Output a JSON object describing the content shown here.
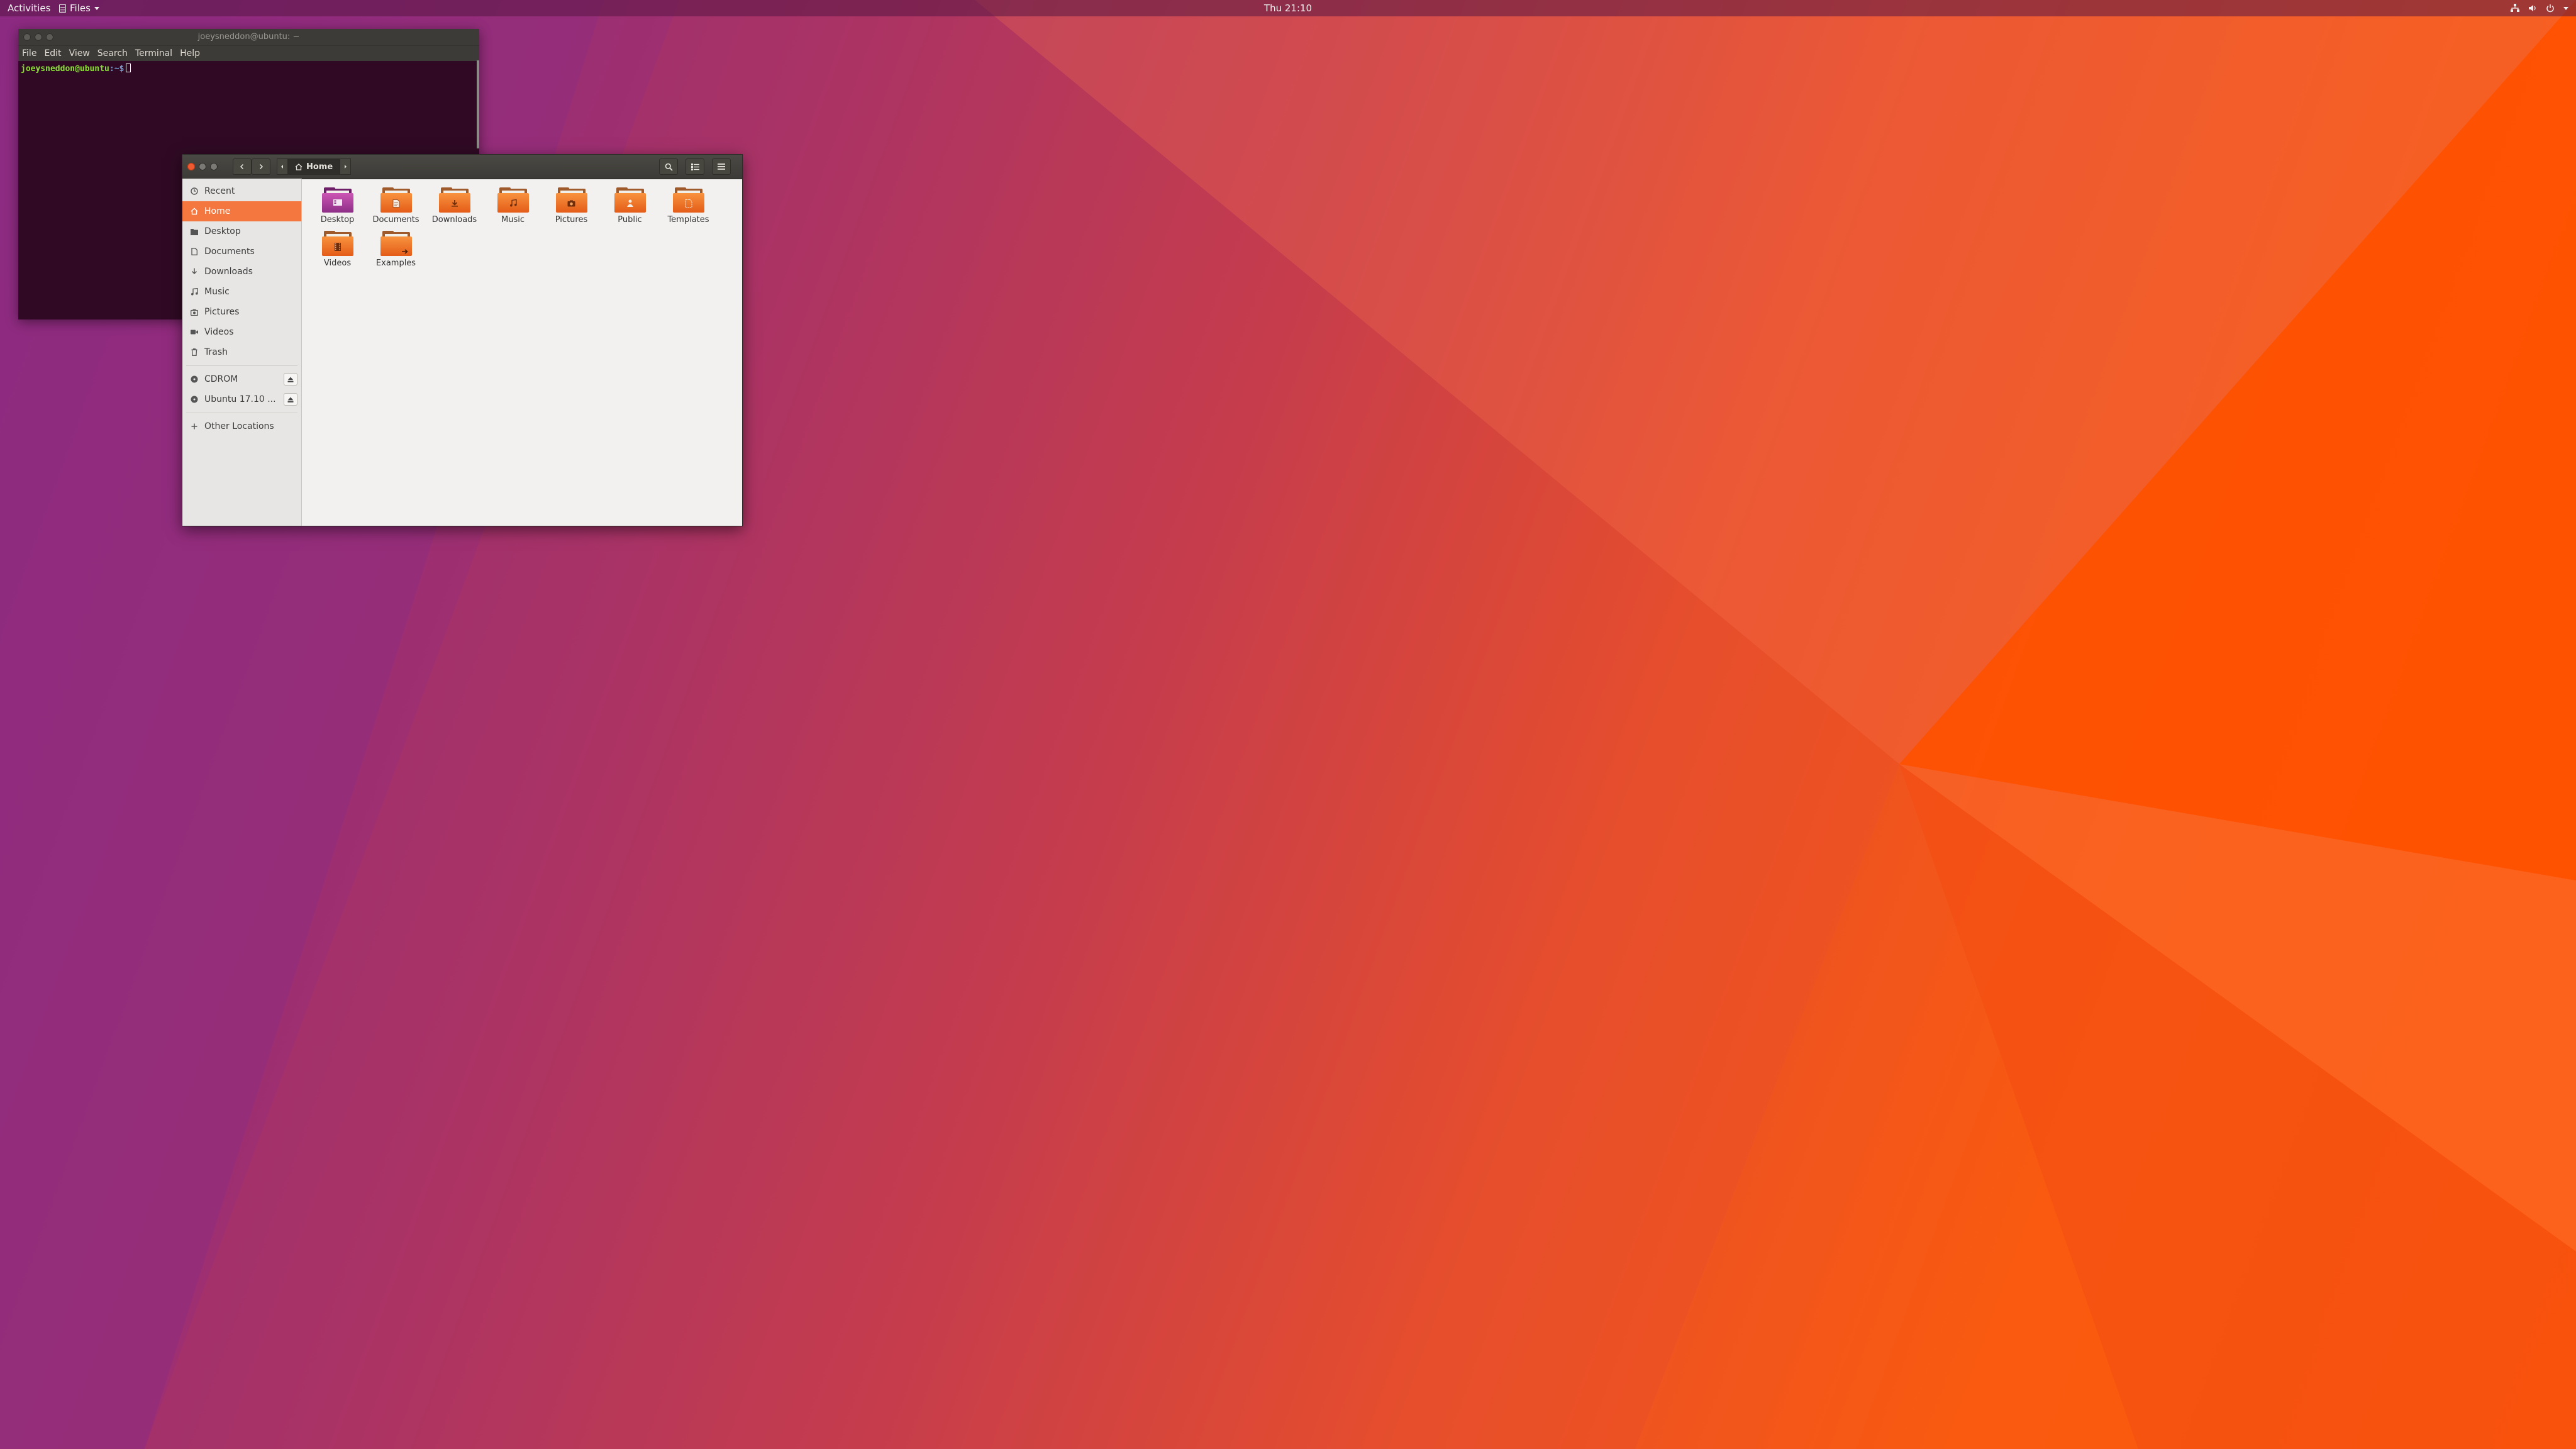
{
  "topbar": {
    "activities": "Activities",
    "app_menu": "Files",
    "clock": "Thu 21:10"
  },
  "terminal": {
    "title": "joeysneddon@ubuntu: ~",
    "menu": [
      "File",
      "Edit",
      "View",
      "Search",
      "Terminal",
      "Help"
    ],
    "prompt_user": "joeysneddon@ubuntu",
    "prompt_path": ":~$"
  },
  "files": {
    "path_current": "Home",
    "sidebar": {
      "places": [
        {
          "label": "Recent",
          "icon": "clock-icon",
          "active": false
        },
        {
          "label": "Home",
          "icon": "home-icon",
          "active": true
        },
        {
          "label": "Desktop",
          "icon": "folder-icon",
          "active": false
        },
        {
          "label": "Documents",
          "icon": "document-icon",
          "active": false
        },
        {
          "label": "Downloads",
          "icon": "download-icon",
          "active": false
        },
        {
          "label": "Music",
          "icon": "music-icon",
          "active": false
        },
        {
          "label": "Pictures",
          "icon": "camera-icon",
          "active": false
        },
        {
          "label": "Videos",
          "icon": "video-icon",
          "active": false
        },
        {
          "label": "Trash",
          "icon": "trash-icon",
          "active": false
        }
      ],
      "devices": [
        {
          "label": "CDROM",
          "icon": "disc-icon"
        },
        {
          "label": "Ubuntu 17.10 ...",
          "icon": "disc-icon"
        }
      ],
      "other": {
        "label": "Other Locations",
        "icon": "plus-icon"
      }
    },
    "items": [
      {
        "name": "Desktop",
        "kind": "desktop"
      },
      {
        "name": "Documents",
        "kind": "documents"
      },
      {
        "name": "Downloads",
        "kind": "downloads"
      },
      {
        "name": "Music",
        "kind": "music"
      },
      {
        "name": "Pictures",
        "kind": "pictures"
      },
      {
        "name": "Public",
        "kind": "public"
      },
      {
        "name": "Templates",
        "kind": "templates"
      },
      {
        "name": "Videos",
        "kind": "videos"
      },
      {
        "name": "Examples",
        "kind": "examples"
      }
    ]
  },
  "colors": {
    "accent": "#f4773f",
    "terminal_bg": "#300a24",
    "headerbar": "#3c3b37"
  }
}
